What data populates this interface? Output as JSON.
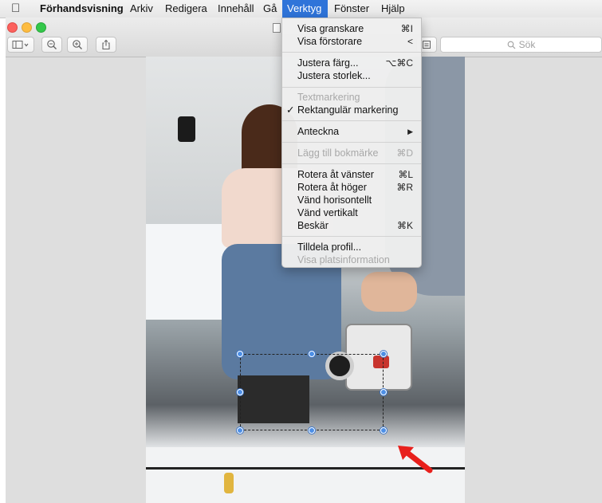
{
  "menubar": {
    "app_name": "Förhandsvisning",
    "items": [
      "Arkiv",
      "Redigera",
      "Innehåll",
      "Gå",
      "Verktyg",
      "Fönster",
      "Hjälp"
    ]
  },
  "toolbar": {
    "search_placeholder": "Sök"
  },
  "verktyg_menu": [
    {
      "label": "Visa granskare",
      "shortcut": "⌘I",
      "enabled": true
    },
    {
      "label": "Visa förstorare",
      "shortcut": "<",
      "enabled": true
    },
    {
      "label": "Justera färg...",
      "shortcut": "⌥⌘C",
      "enabled": true
    },
    {
      "label": "Justera storlek...",
      "shortcut": "",
      "enabled": true
    },
    {
      "label": "Textmarkering",
      "shortcut": "",
      "enabled": false
    },
    {
      "label": "Rektangulär markering",
      "shortcut": "",
      "enabled": true,
      "checked": true
    },
    {
      "label": "Anteckna",
      "shortcut": "▶",
      "enabled": true
    },
    {
      "label": "Lägg till bokmärke",
      "shortcut": "⌘D",
      "enabled": false
    },
    {
      "label": "Rotera åt vänster",
      "shortcut": "⌘L",
      "enabled": true
    },
    {
      "label": "Rotera åt höger",
      "shortcut": "⌘R",
      "enabled": true
    },
    {
      "label": "Vänd horisontellt",
      "shortcut": "",
      "enabled": true
    },
    {
      "label": "Vänd vertikalt",
      "shortcut": "",
      "enabled": true
    },
    {
      "label": "Beskär",
      "shortcut": "⌘K",
      "enabled": true
    },
    {
      "label": "Tilldela profil...",
      "shortcut": "",
      "enabled": true
    },
    {
      "label": "Visa platsinformation",
      "shortcut": "",
      "enabled": false
    }
  ],
  "colors": {
    "menu_highlight": "#2f74d9",
    "selection_handle": "#4d8fe6",
    "annotation_arrow": "#e8201c"
  }
}
